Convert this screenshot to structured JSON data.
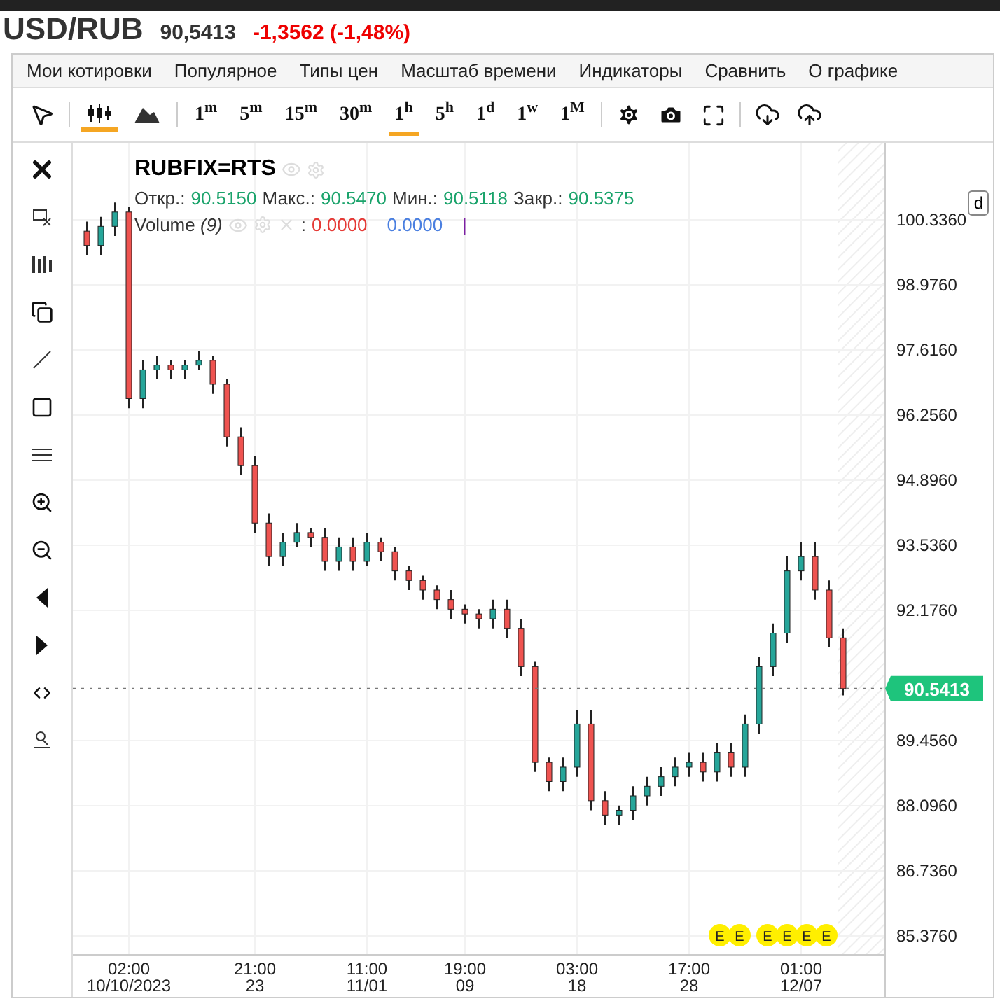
{
  "header": {
    "symbol": "USD/RUB",
    "price": "90,5413",
    "change": "-1,3562 (-1,48%)"
  },
  "menu": [
    "Мои котировки",
    "Популярное",
    "Типы цен",
    "Масштаб времени",
    "Индикаторы",
    "Сравнить",
    "О графике"
  ],
  "chart_types": [
    {
      "kind": "candles",
      "selected": true
    },
    {
      "kind": "area",
      "selected": false
    }
  ],
  "intervals": [
    {
      "value": "1",
      "unit": "m",
      "selected": false
    },
    {
      "value": "5",
      "unit": "m",
      "selected": false
    },
    {
      "value": "15",
      "unit": "m",
      "selected": false
    },
    {
      "value": "30",
      "unit": "m",
      "selected": false
    },
    {
      "value": "1",
      "unit": "h",
      "selected": true
    },
    {
      "value": "5",
      "unit": "h",
      "selected": false
    },
    {
      "value": "1",
      "unit": "d",
      "selected": false
    },
    {
      "value": "1",
      "unit": "w",
      "selected": false
    },
    {
      "value": "1",
      "unit": "M",
      "selected": false
    }
  ],
  "legend": {
    "title": "RUBFIX=RTS",
    "ohlc": [
      {
        "label": "Откр.:",
        "value": "90.5150"
      },
      {
        "label": "Макс.:",
        "value": "90.5470"
      },
      {
        "label": "Мин.:",
        "value": "90.5118"
      },
      {
        "label": "Закр.:",
        "value": "90.5375"
      }
    ],
    "volume": {
      "name": "Volume",
      "param": "(9)",
      "separator": ":",
      "value_1": "0.0000",
      "value_2": "0.0000",
      "marker": "|"
    }
  },
  "side_tag": "d",
  "events": [
    "E",
    "E",
    "E",
    "E",
    "E",
    "E"
  ],
  "chart_data": {
    "type": "candlestick",
    "grid": true,
    "ylim": [
      84.98,
      101.945
    ],
    "yticks": [
      {
        "value": 100.336,
        "label": "100.3360"
      },
      {
        "value": 98.976,
        "label": "98.9760"
      },
      {
        "value": 97.616,
        "label": "97.6160"
      },
      {
        "value": 96.256,
        "label": "96.2560"
      },
      {
        "value": 94.896,
        "label": "94.8960"
      },
      {
        "value": 93.536,
        "label": "93.5360"
      },
      {
        "value": 92.176,
        "label": "92.1760"
      },
      {
        "value": 89.456,
        "label": "89.4560"
      },
      {
        "value": 88.096,
        "label": "88.0960"
      },
      {
        "value": 86.736,
        "label": "86.7360"
      },
      {
        "value": 85.376,
        "label": "85.3760"
      }
    ],
    "categories": [
      null,
      null,
      null,
      "02:00 10/10/2023",
      null,
      null,
      null,
      null,
      null,
      null,
      null,
      null,
      "21:00 23",
      null,
      null,
      null,
      null,
      null,
      null,
      null,
      "11:00 11/01",
      null,
      null,
      null,
      null,
      null,
      null,
      "19:00 09",
      null,
      null,
      null,
      null,
      null,
      null,
      null,
      "03:00 18",
      null,
      null,
      null,
      null,
      null,
      null,
      null,
      "17:00 28",
      null,
      null,
      null,
      null,
      null,
      null,
      null,
      "01:00 12/07",
      null,
      null,
      null
    ],
    "ref_lines": [
      {
        "axis": "y",
        "value": 90.5413,
        "label": "90.5413"
      }
    ],
    "ohlc": [
      [
        100.1,
        100.3,
        99.6,
        99.8
      ],
      [
        99.8,
        100.4,
        99.6,
        100.2
      ],
      [
        100.2,
        100.7,
        100.0,
        100.5
      ],
      [
        100.5,
        100.6,
        96.4,
        96.6
      ],
      [
        96.6,
        97.4,
        96.4,
        97.2
      ],
      [
        97.2,
        97.5,
        97.0,
        97.3
      ],
      [
        97.3,
        97.4,
        97.0,
        97.2
      ],
      [
        97.2,
        97.4,
        97.0,
        97.3
      ],
      [
        97.3,
        97.6,
        97.2,
        97.4
      ],
      [
        97.4,
        97.5,
        96.7,
        96.9
      ],
      [
        96.9,
        97.0,
        95.6,
        95.8
      ],
      [
        95.8,
        96.0,
        95.0,
        95.2
      ],
      [
        95.2,
        95.4,
        93.8,
        94.0
      ],
      [
        94.0,
        94.2,
        93.1,
        93.3
      ],
      [
        93.3,
        93.8,
        93.1,
        93.6
      ],
      [
        93.6,
        94.0,
        93.5,
        93.8
      ],
      [
        93.8,
        93.9,
        93.5,
        93.7
      ],
      [
        93.7,
        93.9,
        93.0,
        93.2
      ],
      [
        93.2,
        93.7,
        93.0,
        93.5
      ],
      [
        93.5,
        93.7,
        93.0,
        93.2
      ],
      [
        93.2,
        93.8,
        93.1,
        93.6
      ],
      [
        93.6,
        93.7,
        93.2,
        93.4
      ],
      [
        93.4,
        93.5,
        92.8,
        93.0
      ],
      [
        93.0,
        93.1,
        92.6,
        92.8
      ],
      [
        92.8,
        92.9,
        92.4,
        92.6
      ],
      [
        92.6,
        92.7,
        92.2,
        92.4
      ],
      [
        92.4,
        92.6,
        92.0,
        92.2
      ],
      [
        92.2,
        92.3,
        91.9,
        92.1
      ],
      [
        92.1,
        92.2,
        91.8,
        92.0
      ],
      [
        92.0,
        92.4,
        91.8,
        92.2
      ],
      [
        92.2,
        92.4,
        91.6,
        91.8
      ],
      [
        91.8,
        92.0,
        90.8,
        91.0
      ],
      [
        91.0,
        91.1,
        88.8,
        89.0
      ],
      [
        89.0,
        89.1,
        88.4,
        88.6
      ],
      [
        88.6,
        89.1,
        88.4,
        88.9
      ],
      [
        88.9,
        90.1,
        88.7,
        89.8
      ],
      [
        89.8,
        90.1,
        88.0,
        88.2
      ],
      [
        88.2,
        88.4,
        87.7,
        87.9
      ],
      [
        87.9,
        88.1,
        87.7,
        88.0
      ],
      [
        88.0,
        88.5,
        87.8,
        88.3
      ],
      [
        88.3,
        88.7,
        88.1,
        88.5
      ],
      [
        88.5,
        88.9,
        88.3,
        88.7
      ],
      [
        88.7,
        89.1,
        88.5,
        88.9
      ],
      [
        88.9,
        89.2,
        88.7,
        89.0
      ],
      [
        89.0,
        89.2,
        88.6,
        88.8
      ],
      [
        88.8,
        89.4,
        88.6,
        89.2
      ],
      [
        89.2,
        89.4,
        88.7,
        88.9
      ],
      [
        88.9,
        90.0,
        88.7,
        89.8
      ],
      [
        89.8,
        91.2,
        89.6,
        91.0
      ],
      [
        91.0,
        91.9,
        90.8,
        91.7
      ],
      [
        91.7,
        93.3,
        91.5,
        93.0
      ],
      [
        93.0,
        93.6,
        92.8,
        93.3
      ],
      [
        93.3,
        93.6,
        92.4,
        92.6
      ],
      [
        92.6,
        92.8,
        91.4,
        91.6
      ],
      [
        91.6,
        91.8,
        90.4,
        90.54
      ]
    ]
  }
}
